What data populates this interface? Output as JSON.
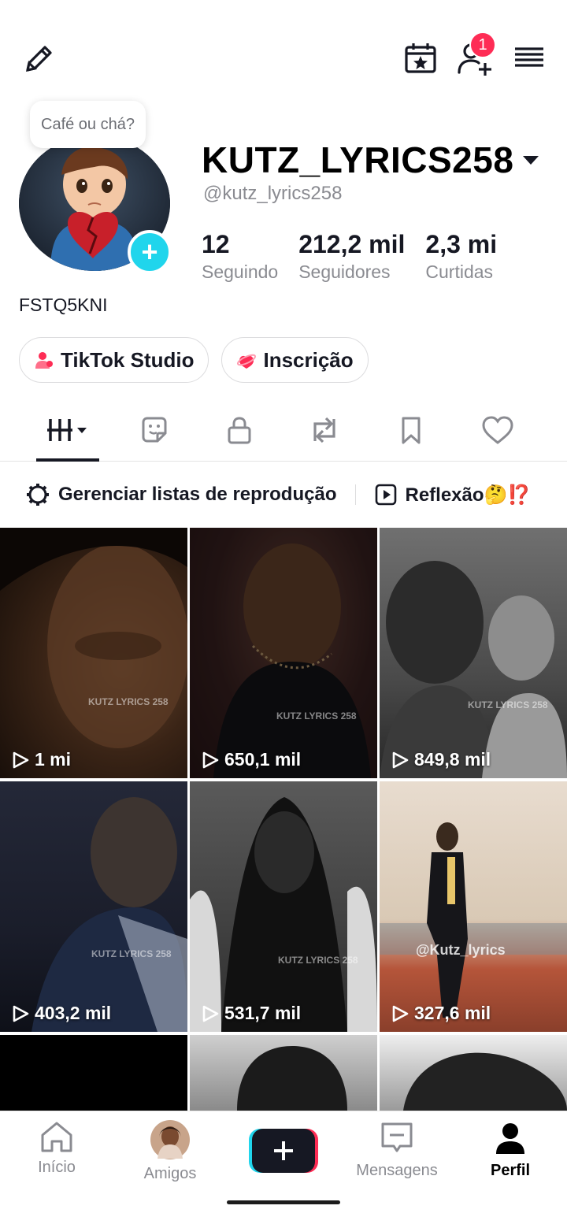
{
  "topbar": {
    "edit_icon": "pencil-icon",
    "calendar_icon": "calendar-star-icon",
    "add_friend_icon": "person-add-icon",
    "menu_icon": "hamburger-menu-icon",
    "notification_count": "1"
  },
  "profile": {
    "bubble_text": "Café ou chá?",
    "username": "KUTZ_LYRICS258",
    "handle": "@kutz_lyrics258",
    "bio": "FSTQ5KNI",
    "stats": [
      {
        "value": "12",
        "label": "Seguindo"
      },
      {
        "value": "212,2 mil",
        "label": "Seguidores"
      },
      {
        "value": "2,3 mi",
        "label": "Curtidas"
      }
    ],
    "buttons": [
      {
        "label": "TikTok Studio",
        "icon": "studio-icon"
      },
      {
        "label": "Inscrição",
        "icon": "subscription-icon"
      }
    ]
  },
  "tabs": [
    {
      "name": "videos",
      "icon": "grid-bars-icon",
      "active": true
    },
    {
      "name": "stickers",
      "icon": "sticker-icon"
    },
    {
      "name": "private",
      "icon": "lock-icon"
    },
    {
      "name": "reposts",
      "icon": "repost-icon"
    },
    {
      "name": "saved",
      "icon": "bookmark-icon"
    },
    {
      "name": "liked",
      "icon": "heart-icon"
    }
  ],
  "playlists": {
    "manage_label": "Gerenciar listas de reprodução",
    "playlist_label": "Reflexão🤔⁉️"
  },
  "videos": [
    {
      "views": "1 mi"
    },
    {
      "views": "650,1 mil"
    },
    {
      "views": "849,8 mil"
    },
    {
      "views": "403,2 mil"
    },
    {
      "views": "531,7 mil"
    },
    {
      "views": "327,6 mil",
      "overlay_text": "@Kutz_lyrics"
    },
    {
      "views": ""
    },
    {
      "views": ""
    },
    {
      "views": ""
    }
  ],
  "watermark": "KUTZ LYRICS 258",
  "bottom_nav": [
    {
      "label": "Início",
      "icon": "home-icon"
    },
    {
      "label": "Amigos",
      "icon": "friend-avatar"
    },
    {
      "label": "",
      "icon": "plus-icon"
    },
    {
      "label": "Mensagens",
      "icon": "message-icon"
    },
    {
      "label": "Perfil",
      "icon": "profile-icon",
      "active": true
    }
  ],
  "colors": {
    "accent": "#fe2c55",
    "cyan": "#20d5ec",
    "text": "#161823",
    "muted": "#8a8b91"
  }
}
